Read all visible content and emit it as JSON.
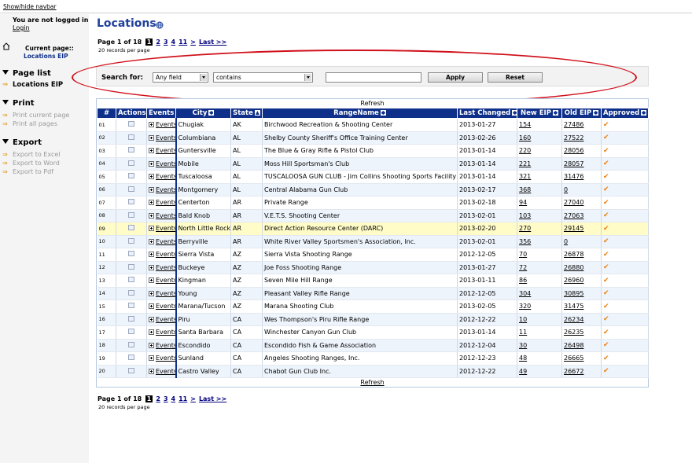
{
  "topbar": {
    "toggle_label": "Show/hide navbar"
  },
  "nav": {
    "login_status": "You are not logged in",
    "login_link": "Login",
    "current_page_label": "Current page::",
    "current_page_value": "Locations EIP",
    "sections": {
      "page_list": {
        "title": "Page list",
        "items": [
          "Locations EIP"
        ]
      },
      "print": {
        "title": "Print",
        "items": [
          "Print current page",
          "Print all pages"
        ]
      },
      "export": {
        "title": "Export",
        "items": [
          "Export to Excel",
          "Export to Word",
          "Export to Pdf"
        ]
      }
    }
  },
  "main": {
    "title": "Locations",
    "pager": {
      "label": "Page 1 of 18",
      "current": "1",
      "pages": [
        "2",
        "3",
        "4",
        "11"
      ],
      "next": ">",
      "last": "Last >>"
    },
    "records_per_page": "20 records per page",
    "search": {
      "label": "Search for:",
      "field_value": "Any field",
      "operator_value": "contains",
      "query_value": "",
      "apply_label": "Apply",
      "reset_label": "Reset"
    },
    "refresh_label": "Refresh",
    "columns": [
      "#",
      "Actions",
      "Events",
      "City",
      "State",
      "RangeName",
      "Last Changed",
      "New EIP",
      "Old EIP",
      "Approved"
    ],
    "events_link": "Events",
    "rows": [
      {
        "num": "01",
        "city": "Chugiak",
        "state": "AK",
        "range": "Birchwood Recreation & Shooting Center",
        "changed": "2013-01-27",
        "new_eip": "154",
        "old_eip": "27486",
        "approved": "✔"
      },
      {
        "num": "02",
        "city": "Columbiana",
        "state": "AL",
        "range": "Shelby County Sheriff's Office Training Center",
        "changed": "2013-02-26",
        "new_eip": "160",
        "old_eip": "27522",
        "approved": "✔"
      },
      {
        "num": "03",
        "city": "Guntersville",
        "state": "AL",
        "range": "The Blue & Gray Rifle & Pistol Club",
        "changed": "2013-01-14",
        "new_eip": "220",
        "old_eip": "28056",
        "approved": "✔"
      },
      {
        "num": "04",
        "city": "Mobile",
        "state": "AL",
        "range": "Moss Hill Sportsman's Club",
        "changed": "2013-01-14",
        "new_eip": "221",
        "old_eip": "28057",
        "approved": "✔"
      },
      {
        "num": "05",
        "city": "Tuscaloosa",
        "state": "AL",
        "range": "TUSCALOOSA GUN CLUB - Jim Collins Shooting Sports Facility",
        "changed": "2013-01-14",
        "new_eip": "321",
        "old_eip": "31476",
        "approved": "✔"
      },
      {
        "num": "06",
        "city": "Montgomery",
        "state": "AL",
        "range": "Central Alabama Gun Club",
        "changed": "2013-02-17",
        "new_eip": "368",
        "old_eip": "0",
        "approved": "✔"
      },
      {
        "num": "07",
        "city": "Centerton",
        "state": "AR",
        "range": "Private Range",
        "changed": "2013-02-18",
        "new_eip": "94",
        "old_eip": "27040",
        "approved": "✔"
      },
      {
        "num": "08",
        "city": "Bald Knob",
        "state": "AR",
        "range": "V.E.T.S. Shooting Center",
        "changed": "2013-02-01",
        "new_eip": "103",
        "old_eip": "27063",
        "approved": "✔"
      },
      {
        "num": "09",
        "city": "North Little Rock",
        "state": "AR",
        "range": "Direct Action Resource Center (DARC)",
        "changed": "2013-02-20",
        "new_eip": "270",
        "old_eip": "29145",
        "approved": "✔"
      },
      {
        "num": "10",
        "city": "Berryville",
        "state": "AR",
        "range": "White River Valley Sportsmen's Association, Inc.",
        "changed": "2013-02-01",
        "new_eip": "356",
        "old_eip": "0",
        "approved": "✔"
      },
      {
        "num": "11",
        "city": "Sierra Vista",
        "state": "AZ",
        "range": "Sierra Vista Shooting Range",
        "changed": "2012-12-05",
        "new_eip": "70",
        "old_eip": "26878",
        "approved": "✔"
      },
      {
        "num": "12",
        "city": "Buckeye",
        "state": "AZ",
        "range": "Joe Foss Shooting Range",
        "changed": "2013-01-27",
        "new_eip": "72",
        "old_eip": "26880",
        "approved": "✔"
      },
      {
        "num": "13",
        "city": "Kingman",
        "state": "AZ",
        "range": "Seven Mile Hill Range",
        "changed": "2013-01-11",
        "new_eip": "86",
        "old_eip": "26960",
        "approved": "✔"
      },
      {
        "num": "14",
        "city": "Young",
        "state": "AZ",
        "range": "Pleasant Valley Rifle Range",
        "changed": "2012-12-05",
        "new_eip": "304",
        "old_eip": "30895",
        "approved": "✔"
      },
      {
        "num": "15",
        "city": "Marana/Tucson",
        "state": "AZ",
        "range": "Marana Shooting Club",
        "changed": "2013-02-05",
        "new_eip": "320",
        "old_eip": "31475",
        "approved": "✔"
      },
      {
        "num": "16",
        "city": "Piru",
        "state": "CA",
        "range": "Wes Thompson's Piru Rifle Range",
        "changed": "2012-12-22",
        "new_eip": "10",
        "old_eip": "26234",
        "approved": "✔"
      },
      {
        "num": "17",
        "city": "Santa Barbara",
        "state": "CA",
        "range": "Winchester Canyon Gun Club",
        "changed": "2013-01-14",
        "new_eip": "11",
        "old_eip": "26235",
        "approved": "✔"
      },
      {
        "num": "18",
        "city": "Escondido",
        "state": "CA",
        "range": "Escondido Fish & Game Association",
        "changed": "2012-12-04",
        "new_eip": "30",
        "old_eip": "26498",
        "approved": "✔"
      },
      {
        "num": "19",
        "city": "Sunland",
        "state": "CA",
        "range": "Angeles Shooting Ranges, Inc.",
        "changed": "2012-12-23",
        "new_eip": "48",
        "old_eip": "26665",
        "approved": "✔"
      },
      {
        "num": "20",
        "city": "Castro Valley",
        "state": "CA",
        "range": "Chabot Gun Club Inc.",
        "changed": "2012-12-22",
        "new_eip": "49",
        "old_eip": "26672",
        "approved": "✔"
      }
    ],
    "highlighted_row": "09"
  },
  "colors": {
    "header_bg": "#0e2f8a",
    "title": "#20409a",
    "row_alt": "#eef4fc",
    "row_highlight": "#fffcc8",
    "annotation_ellipse": "#d0101a",
    "approved_check": "#f08010"
  },
  "icons": {
    "current_page": "home-icon",
    "title": "globe-icon",
    "nav_bullet": "double-arrow-icon",
    "action": "edit-record-icon",
    "expand": "plus-box-icon",
    "sort": "sort-icon",
    "approved": "checkmark-icon"
  }
}
